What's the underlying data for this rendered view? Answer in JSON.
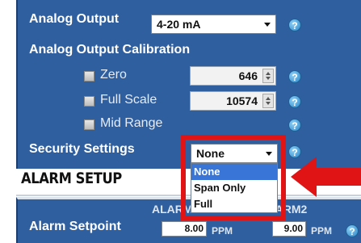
{
  "analog_output": {
    "label": "Analog Output",
    "selected": "4-20 mA",
    "help": "?"
  },
  "calibration": {
    "title": "Analog Output Calibration",
    "zero": {
      "label": "Zero",
      "value": "646",
      "help": "?"
    },
    "full_scale": {
      "label": "Full Scale",
      "value": "10574",
      "help": "?"
    },
    "mid_range": {
      "label": "Mid Range",
      "help": "?"
    }
  },
  "security": {
    "label": "Security Settings",
    "selected": "None",
    "help": "?",
    "options": [
      "None",
      "Span Only",
      "Full"
    ]
  },
  "alarm_setup": {
    "title": "ALARM SETUP",
    "col1_header": "ALARM1",
    "col2_header": "ALARM2",
    "setpoint_label": "Alarm Setpoint",
    "alarm1_value": "8.00",
    "alarm2_value": "9.00",
    "unit": "PPM",
    "help": "?"
  },
  "colors": {
    "panel": "#2f5f9f",
    "highlight": "#e01414",
    "selection": "#3875d7"
  }
}
